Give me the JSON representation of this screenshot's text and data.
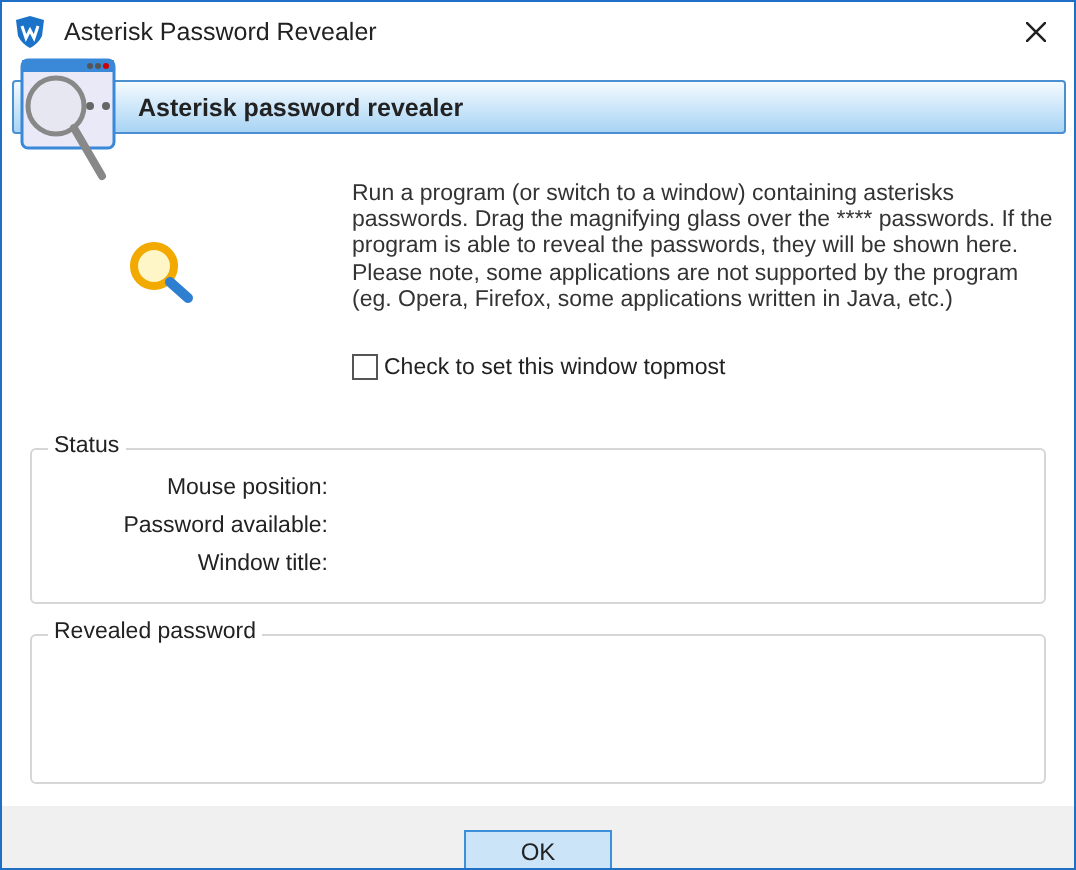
{
  "window": {
    "title": "Asterisk Password Revealer"
  },
  "header": {
    "title": "Asterisk password revealer"
  },
  "description": "Run a program (or switch to a window) containing asterisks passwords. Drag the magnifying glass over the **** passwords. If the program is able to reveal the passwords, they will be shown here. Please note, some applications are not supported by the program (eg. Opera, Firefox, some applications written in Java, etc.)",
  "topmost": {
    "label": "Check to set this window topmost",
    "checked": false
  },
  "status": {
    "title": "Status",
    "fields": [
      "Mouse position:",
      "Password available:",
      "Window title:"
    ]
  },
  "revealed": {
    "title": "Revealed password"
  },
  "buttons": [
    "OK"
  ]
}
